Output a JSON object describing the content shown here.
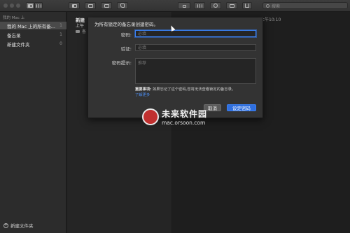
{
  "toolbar": {
    "search_placeholder": "搜索"
  },
  "sidebar": {
    "section_title": "我的 Mac 上",
    "items": [
      {
        "label": "我的 Mac 上的所有备...",
        "count": "1"
      },
      {
        "label": "备忘录",
        "count": "1"
      },
      {
        "label": "新建文件夹",
        "count": "0"
      }
    ],
    "new_folder_label": "新建文件夹"
  },
  "notelist": {
    "title": "新建",
    "time": "上午",
    "folder": "备"
  },
  "editor": {
    "date": "上午10:10"
  },
  "dialog": {
    "message": "为所有锁定的备忘录创建密码。",
    "password_label": "密码:",
    "password_placeholder": "必填",
    "verify_label": "验证:",
    "verify_placeholder": "必填",
    "hint_label": "密码提示:",
    "hint_placeholder": "推荐",
    "notice_bold": "重要事项:",
    "notice_text": "如果忘记了这个密码,您将无法查看锁定的备忘录。",
    "learn_more": "了解更多",
    "cancel_label": "取消",
    "ok_label": "设定密码"
  },
  "watermark": {
    "name": "未来软件园",
    "url": "mac.orsoon.com"
  },
  "colors": {
    "accent": "#2f6fdf",
    "focus_ring": "#3a82f7"
  }
}
